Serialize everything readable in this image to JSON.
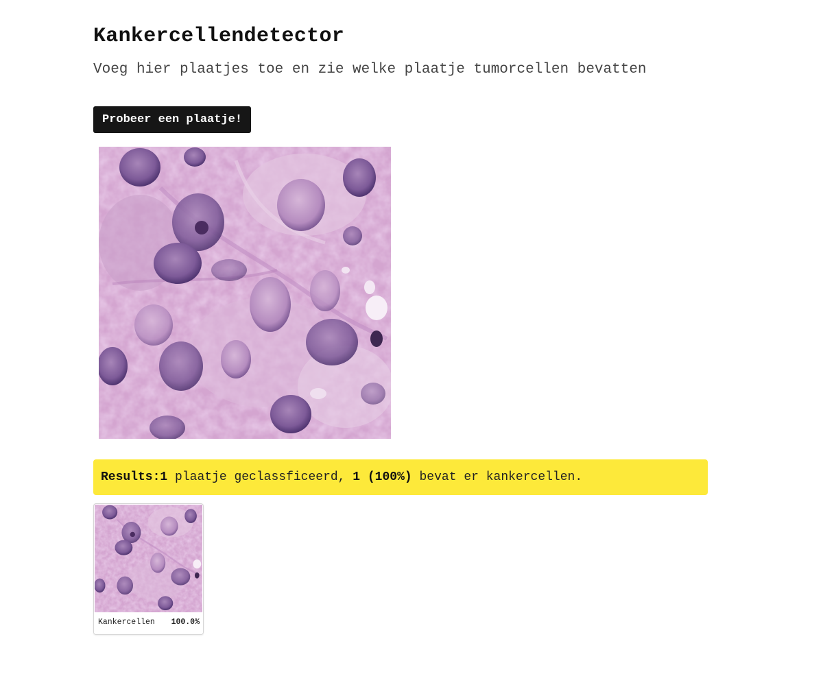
{
  "page": {
    "title": "Kankercellendetector",
    "subtitle": "Voeg hier plaatjes toe en zie welke plaatje tumorcellen bevatten"
  },
  "upload": {
    "button_label": "Probeer een plaatje!"
  },
  "results": {
    "label": "Results:",
    "count": "1",
    "classified_text": " plaatje geclassficeerd, ",
    "positive": "1 (100%)",
    "positive_text": " bevat er kankercellen."
  },
  "thumbnails": [
    {
      "label": "Kankercellen",
      "score": "100.0%"
    }
  ],
  "colors": {
    "button_bg": "#161616",
    "results_bg": "#fde93a",
    "tissue_base": "#d7a8d3",
    "nucleus": "#6b4a86"
  }
}
